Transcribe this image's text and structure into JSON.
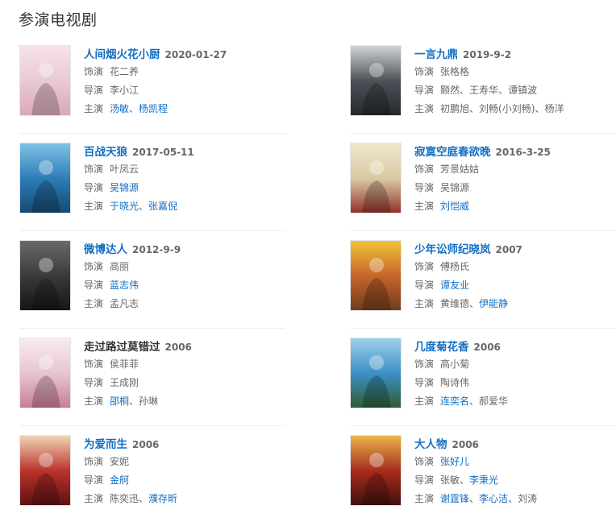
{
  "section_title": "参演电视剧",
  "labels": {
    "role": "饰演",
    "director": "导演",
    "starring": "主演"
  },
  "colors": {
    "link": "#136ec2",
    "text": "#666666",
    "divider": "#eeeeee"
  },
  "items": [
    {
      "title": "人间烟火花小厨",
      "title_link": true,
      "year": "2020-01-27",
      "role": [
        {
          "t": "花二养",
          "link": false
        }
      ],
      "director": [
        {
          "t": "李小江",
          "link": false
        }
      ],
      "starring": [
        {
          "t": "汤敏",
          "link": true
        },
        {
          "t": "杨凯程",
          "link": true
        }
      ],
      "poster_colors": [
        "#f7e3ea",
        "#e9c8d6",
        "#d9a7b9"
      ]
    },
    {
      "title": "一言九鼎",
      "title_link": true,
      "year": "2019-9-2",
      "role": [
        {
          "t": "张格格",
          "link": false
        }
      ],
      "director": [
        {
          "t": "颢然",
          "link": false
        },
        {
          "t": "王寿华",
          "link": false
        },
        {
          "t": "谭镇波",
          "link": false
        }
      ],
      "starring": [
        {
          "t": "初鹏旭",
          "link": false
        },
        {
          "t": "刘畅(小刘畅)",
          "link": false
        },
        {
          "t": "杨洋",
          "link": false
        }
      ],
      "poster_colors": [
        "#cfd3d6",
        "#4b5157",
        "#23272b"
      ]
    },
    {
      "title": "百战天狼",
      "title_link": true,
      "year": "2017-05-11",
      "role": [
        {
          "t": "叶凤云",
          "link": false
        }
      ],
      "director": [
        {
          "t": "吴锦源",
          "link": true
        }
      ],
      "starring": [
        {
          "t": "于晓光",
          "link": true
        },
        {
          "t": "张嘉倪",
          "link": true
        }
      ],
      "poster_colors": [
        "#7ec3e6",
        "#2c7db6",
        "#15466f"
      ]
    },
    {
      "title": "寂寞空庭春欲晚",
      "title_link": true,
      "year": "2016-3-25",
      "role": [
        {
          "t": "芳景姑姑",
          "link": false
        }
      ],
      "director": [
        {
          "t": "吴锦源",
          "link": false
        }
      ],
      "starring": [
        {
          "t": "刘恺威",
          "link": true
        }
      ],
      "poster_colors": [
        "#efe6cf",
        "#d8c9a0",
        "#8f2b26"
      ]
    },
    {
      "title": "微博达人",
      "title_link": true,
      "year": "2012-9-9",
      "role": [
        {
          "t": "高丽",
          "link": false
        }
      ],
      "director": [
        {
          "t": "蓝志伟",
          "link": true
        }
      ],
      "starring": [
        {
          "t": "孟凡志",
          "link": false
        }
      ],
      "poster_colors": [
        "#6a6a6a",
        "#3a3a3a",
        "#141414"
      ]
    },
    {
      "title": "少年讼师纪晓岚",
      "title_link": true,
      "year": "2007",
      "role": [
        {
          "t": "傅杨氏",
          "link": false
        }
      ],
      "director": [
        {
          "t": "谭友业",
          "link": true
        }
      ],
      "starring": [
        {
          "t": "黄维德",
          "link": false
        },
        {
          "t": "伊能静",
          "link": true
        }
      ],
      "poster_colors": [
        "#f0c23a",
        "#c7642a",
        "#6b3b1d"
      ]
    },
    {
      "title": "走过路过莫错过",
      "title_link": false,
      "year": "2006",
      "role": [
        {
          "t": "侯菲菲",
          "link": false
        }
      ],
      "director": [
        {
          "t": "王成刚",
          "link": false
        }
      ],
      "starring": [
        {
          "t": "邵桐",
          "link": true
        },
        {
          "t": "孙琳",
          "link": false
        }
      ],
      "poster_colors": [
        "#f8ecef",
        "#e7c4cf",
        "#c77a92"
      ]
    },
    {
      "title": "几度菊花香",
      "title_link": true,
      "year": "2006",
      "role": [
        {
          "t": "高小菊",
          "link": false
        }
      ],
      "director": [
        {
          "t": "陶诗伟",
          "link": false
        }
      ],
      "starring": [
        {
          "t": "连奕名",
          "link": true
        },
        {
          "t": "郝爱华",
          "link": false
        }
      ],
      "poster_colors": [
        "#9fd0ea",
        "#3b8fc3",
        "#2d5a2a"
      ]
    },
    {
      "title": "为爱而生",
      "title_link": true,
      "year": "2006",
      "role": [
        {
          "t": "安妮",
          "link": false
        }
      ],
      "director": [
        {
          "t": "金舸",
          "link": true
        }
      ],
      "starring": [
        {
          "t": "陈奕迅",
          "link": false
        },
        {
          "t": "濮存昕",
          "link": true
        }
      ],
      "poster_colors": [
        "#f1d3b5",
        "#b8322a",
        "#5a1010"
      ]
    },
    {
      "title": "大人物",
      "title_link": true,
      "year": "2006",
      "role": [
        {
          "t": "张好儿",
          "link": true
        }
      ],
      "director": [
        {
          "t": "张敏",
          "link": false
        },
        {
          "t": "李秉光",
          "link": true
        }
      ],
      "starring": [
        {
          "t": "谢霆锋",
          "link": true
        },
        {
          "t": "李心洁",
          "link": true
        },
        {
          "t": "刘涛",
          "link": false
        }
      ],
      "poster_colors": [
        "#e9b54a",
        "#a62a1c",
        "#3d120c"
      ]
    }
  ]
}
